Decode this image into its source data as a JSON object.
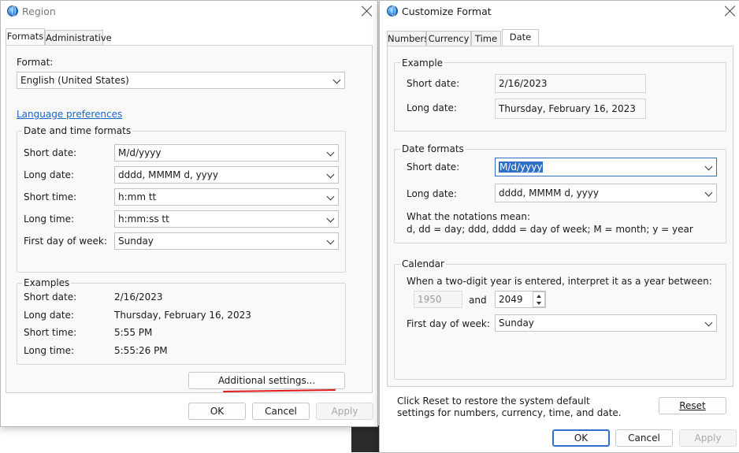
{
  "region": {
    "title": "Region",
    "tabs": [
      {
        "label": "Formats"
      },
      {
        "label": "Administrative"
      }
    ],
    "format_label": "Format:",
    "format_value": "English (United States)",
    "language_link": "Language preferences",
    "date_time_group": "Date and time formats",
    "rows": [
      {
        "label": "Short date:",
        "value": "M/d/yyyy"
      },
      {
        "label": "Long date:",
        "value": "dddd, MMMM d, yyyy"
      },
      {
        "label": "Short time:",
        "value": "h:mm tt"
      },
      {
        "label": "Long time:",
        "value": "h:mm:ss tt"
      },
      {
        "label": "First day of week:",
        "value": "Sunday"
      }
    ],
    "examples_group": "Examples",
    "examples": [
      {
        "label": "Short date:",
        "value": "2/16/2023"
      },
      {
        "label": "Long date:",
        "value": "Thursday, February 16, 2023"
      },
      {
        "label": "Short time:",
        "value": "5:55 PM"
      },
      {
        "label": "Long time:",
        "value": "5:55:26 PM"
      }
    ],
    "additional_settings": "Additional settings...",
    "ok": "OK",
    "cancel": "Cancel",
    "apply": "Apply"
  },
  "customize": {
    "title": "Customize Format",
    "tabs": [
      {
        "label": "Numbers"
      },
      {
        "label": "Currency"
      },
      {
        "label": "Time"
      },
      {
        "label": "Date"
      }
    ],
    "example_group": "Example",
    "example_short_label": "Short date:",
    "example_short_value": "2/16/2023",
    "example_long_label": "Long date:",
    "example_long_value": "Thursday, February 16, 2023",
    "date_formats_group": "Date formats",
    "short_date_label": "Short date:",
    "short_date_value": "M/d/yyyy",
    "long_date_label": "Long date:",
    "long_date_value": "dddd, MMMM d, yyyy",
    "notation_title": "What the notations mean:",
    "notation_text": "d, dd = day;  ddd, dddd = day of week;  M = month;  y = year",
    "calendar_group": "Calendar",
    "two_digit_text": "When a two-digit year is entered, interpret it as a year between:",
    "year_from": "1950",
    "and_label": "and",
    "year_to": "2049",
    "first_day_label": "First day of week:",
    "first_day_value": "Sunday",
    "reset_text": "Click Reset to restore the system default settings for numbers, currency, time, and date.",
    "reset": "Reset",
    "ok": "OK",
    "cancel": "Cancel",
    "apply": "Apply"
  },
  "colors": {
    "accent": "#1765c9",
    "annotation": "#e0191b",
    "selection": "#2f6fc7"
  }
}
